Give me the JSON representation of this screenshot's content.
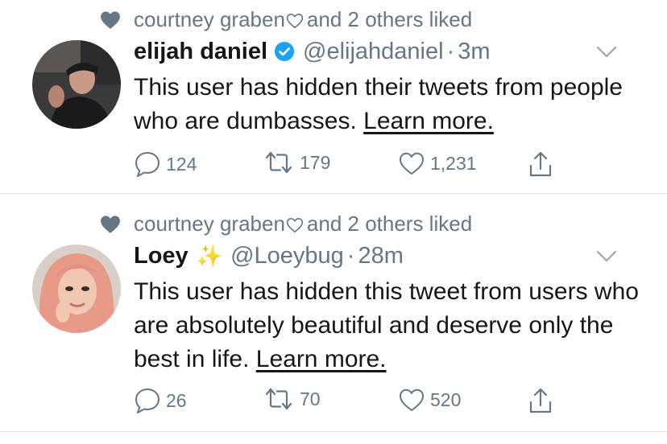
{
  "tweets": [
    {
      "liked_by": "courtney graben",
      "liked_suffix": "and 2 others liked",
      "name": "elijah daniel",
      "verified": true,
      "handle": "@elijahdaniel",
      "dot": "·",
      "time": "3m",
      "text": "This user has hidden their tweets from people who are dumbasses.",
      "learn_more": "Learn more.",
      "replies": "124",
      "retweets": "179",
      "likes": "1,231"
    },
    {
      "liked_by": "courtney graben",
      "liked_suffix": "and 2 others liked",
      "name": "Loey",
      "name_emoji": "✨",
      "handle": "@Loeybug",
      "dot": "·",
      "time": "28m",
      "text": "This user has hidden this tweet from users who are absolutely beautiful and deserve only the best in life.",
      "learn_more": "Learn more.",
      "replies": "26",
      "retweets": "70",
      "likes": "520"
    }
  ],
  "colors": {
    "text": "#14171a",
    "secondary": "#657786",
    "verified": "#1da1f2",
    "divider": "#dfe3e7"
  },
  "icons": [
    "heart-icon",
    "verified-badge-icon",
    "chevron-down-icon",
    "reply-icon",
    "retweet-icon",
    "like-icon",
    "share-icon"
  ]
}
